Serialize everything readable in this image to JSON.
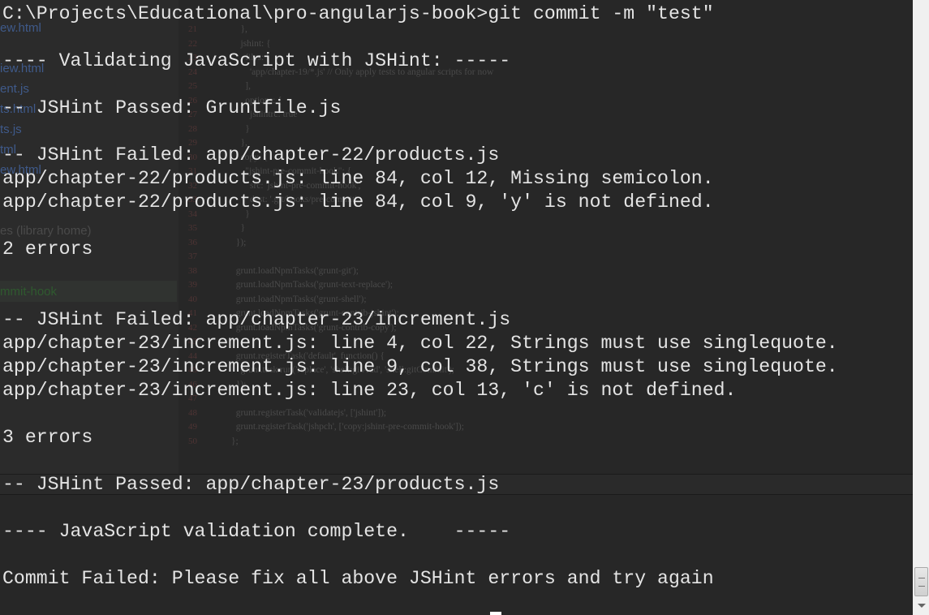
{
  "terminal": {
    "lines": [
      "C:\\Projects\\Educational\\pro-angularjs-book>git commit -m \"test\"",
      "",
      "---- Validating JavaScript with JSHint: -----",
      "",
      "-- JSHint Passed: Gruntfile.js",
      "",
      "-- JSHint Failed: app/chapter-22/products.js",
      "app/chapter-22/products.js: line 84, col 12, Missing semicolon.",
      "app/chapter-22/products.js: line 84, col 9, 'y' is not defined.",
      "",
      "2 errors",
      "",
      "",
      "-- JSHint Failed: app/chapter-23/increment.js",
      "app/chapter-23/increment.js: line 4, col 22, Strings must use singlequote.",
      "app/chapter-23/increment.js: line 9, col 38, Strings must use singlequote.",
      "app/chapter-23/increment.js: line 23, col 13, 'c' is not defined.",
      "",
      "3 errors",
      "",
      "-- JSHint Passed: app/chapter-23/products.js",
      "",
      "---- JavaScript validation complete.    -----",
      "",
      "Commit Failed: Please fix all above JSHint errors and try again"
    ]
  },
  "ide": {
    "sidebar_items": [
      "ew.html",
      "iew.html",
      "ent.js",
      "ts.html",
      "ts.js",
      "tml",
      "ew.html",
      "es (library home)",
      "mmit-hook"
    ],
    "line_numbers": [
      "21",
      "22",
      "23",
      "24",
      "25",
      "26",
      "27",
      "28",
      "29",
      "30",
      "31",
      "32",
      "33",
      "34",
      "35",
      "36",
      "37",
      "38",
      "39",
      "40",
      "41",
      "42",
      "43",
      "44",
      "45",
      "46",
      "47",
      "48",
      "49",
      "50"
    ],
    "code_lines": [
      "    },",
      "    jshint: {",
      "      files: [",
      "        'app/chapter-19/*.js' // Only apply tests to angular scripts for now",
      "      ],",
      "      options: {",
      "        jshintrc: true",
      "      }",
      "    },",
      "    copy: {",
      "      \"jshint-pre-commit-hook\": {",
      "        src: 'jshint-pre-commit-hook',",
      "        dest: '.git/hooks/pre-commit'",
      "      }",
      "    }",
      "  });",
      "",
      "  grunt.loadNpmTasks('grunt-git');",
      "  grunt.loadNpmTasks('grunt-text-replace');",
      "  grunt.loadNpmTasks('grunt-shell');",
      "  grunt.loadNpmTasks('grunt-contrib-jshint');",
      "  grunt.loadNpmTasks('grunt-contrib-copy');",
      "",
      "  grunt.registerTask('default', function() {",
      "    grunt.task.run('replace', 'shell:gitAdd', 'shell:gitCommit');",
      "  });",
      "",
      "  grunt.registerTask('validatejs', ['jshint']);",
      "  grunt.registerTask('jshpch', ['copy:jshint-pre-commit-hook']);",
      "};"
    ]
  },
  "colors": {
    "terminal_bg": "#272727",
    "terminal_text": "#e4e4e4"
  }
}
